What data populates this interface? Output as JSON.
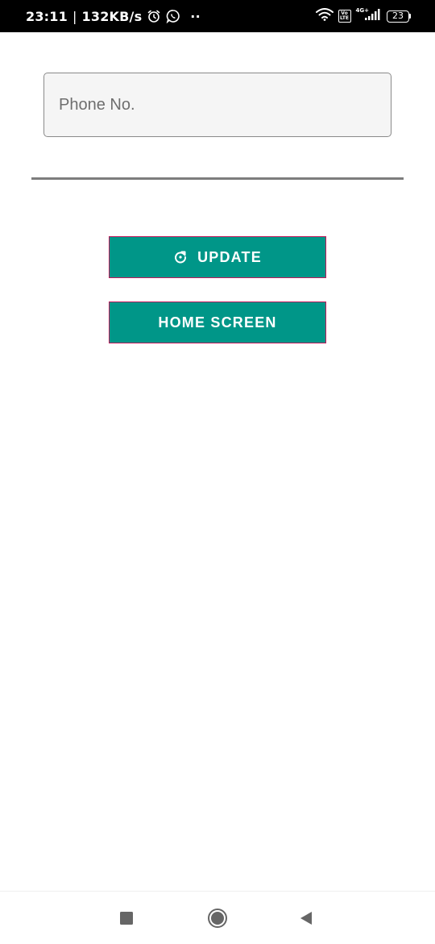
{
  "status_bar": {
    "time": "23:11",
    "separator": "|",
    "speed": "132KB/s",
    "overflow_dots": "··",
    "volte_top": "Vo",
    "volte_bottom": "LTE",
    "network": "4G+",
    "battery": "23"
  },
  "form": {
    "phone_placeholder": "Phone No.",
    "phone_value": ""
  },
  "buttons": {
    "update_label": "UPDATE",
    "home_label": "HOME SCREEN"
  },
  "colors": {
    "button_bg": "#009688",
    "button_border": "#c2185b",
    "status_bar_bg": "#000000",
    "divider": "#7d7d7d"
  },
  "icons": {
    "update": "refresh-icon",
    "alarm": "alarm-icon",
    "whatsapp": "whatsapp-icon",
    "wifi": "wifi-icon",
    "signal": "signal-icon",
    "recent": "recent-apps-icon",
    "home": "home-icon",
    "back": "back-icon"
  }
}
